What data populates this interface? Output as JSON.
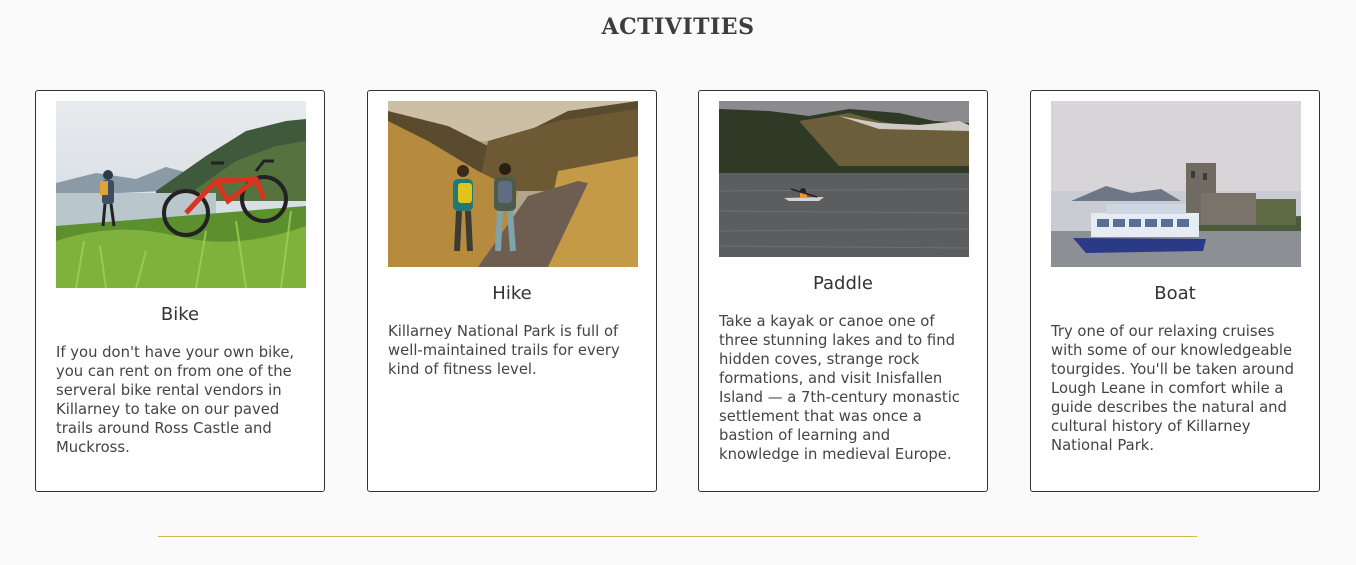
{
  "section": {
    "title": "ACTIVITIES"
  },
  "cards": [
    {
      "title": "Bike",
      "text": "If you don't have your own bike, you can rent on from one of the serveral bike rental vendors in Killarney to take on our paved trails around Ross Castle and Muckross.",
      "image_icon": "bike-photo"
    },
    {
      "title": "Hike",
      "text": "Killarney National Park is full of well-maintained trails for every kind of fitness level.",
      "image_icon": "hikers-photo"
    },
    {
      "title": "Paddle",
      "text": "Take a kayak or canoe one of three stunning lakes and to find hidden coves, strange rock formations, and visit Inisfallen Island — a 7th-century monastic settlement that was once a bastion of learning and knowledge in medieval Europe.",
      "image_icon": "kayak-photo"
    },
    {
      "title": "Boat",
      "text": "Try one of our relaxing cruises with some of our knowledgeable tourgides. You'll be taken around Lough Leane in comfort while a guide describes the natural and cultural history of Killarney National Park.",
      "image_icon": "boat-castle-photo"
    }
  ],
  "colors": {
    "divider": "#d6b553",
    "background": "#fafafa",
    "card_border": "#333333"
  }
}
